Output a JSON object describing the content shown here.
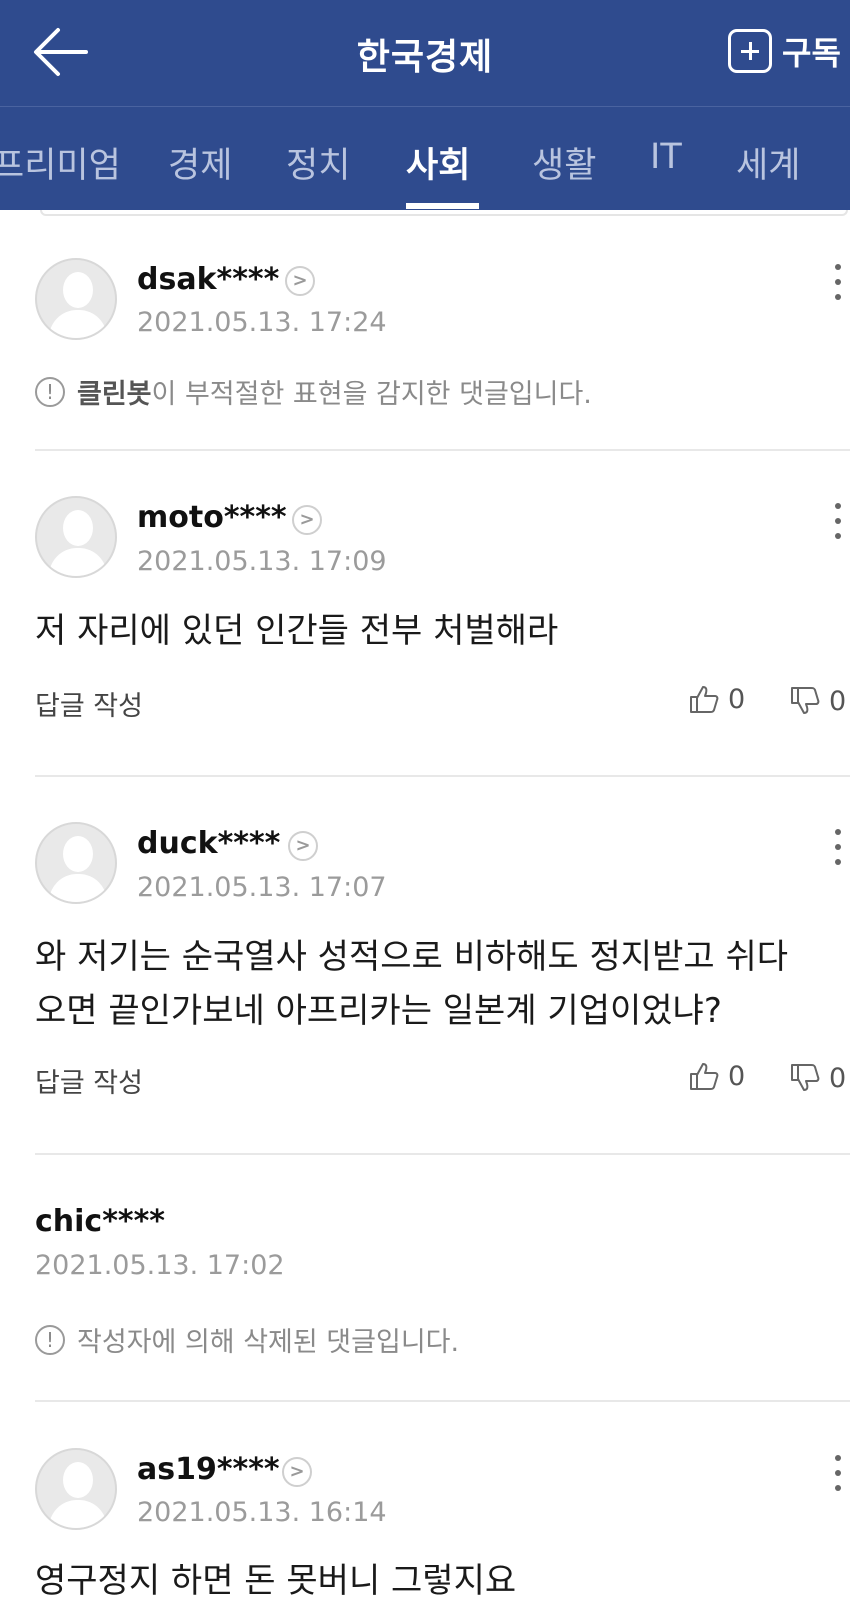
{
  "header": {
    "title": "한국경제",
    "subscribe_label": "구독",
    "icons": {
      "back": "back-arrow-icon",
      "subscribe": "plus-square-icon"
    },
    "bg_color": "#2f4b8e"
  },
  "tabs": [
    {
      "label": "프리미엄",
      "active": false
    },
    {
      "label": "경제",
      "active": false
    },
    {
      "label": "정치",
      "active": false
    },
    {
      "label": "사회",
      "active": true
    },
    {
      "label": "생활",
      "active": false
    },
    {
      "label": "IT",
      "active": false
    },
    {
      "label": "세계",
      "active": false
    }
  ],
  "comments": [
    {
      "user": "dsak****",
      "time": "2021.05.13. 17:24",
      "notice_bold": "클린봇",
      "notice_rest": "이 부적절한 표현을 감지한 댓글입니다."
    },
    {
      "user": "moto****",
      "time": "2021.05.13. 17:09",
      "text": "저 자리에 있던 인간들 전부 처벌해라",
      "reply_label": "답글 작성",
      "likes": "0",
      "dislikes": "0"
    },
    {
      "user": "duck****",
      "time": "2021.05.13. 17:07",
      "text_line1": "와 저기는 순국열사 성적으로 비하해도 정지받고 쉬다",
      "text_line2": "오면 끝인가보네 아프리카는 일본계 기업이었냐?",
      "reply_label": "답글 작성",
      "likes": "0",
      "dislikes": "0"
    },
    {
      "user": "chic****",
      "time": "2021.05.13. 17:02",
      "notice": "작성자에 의해 삭제된 댓글입니다."
    },
    {
      "user": "as19****",
      "time": "2021.05.13. 16:14",
      "text": "영구정지 하면 돈 못버니 그렇지요"
    }
  ]
}
